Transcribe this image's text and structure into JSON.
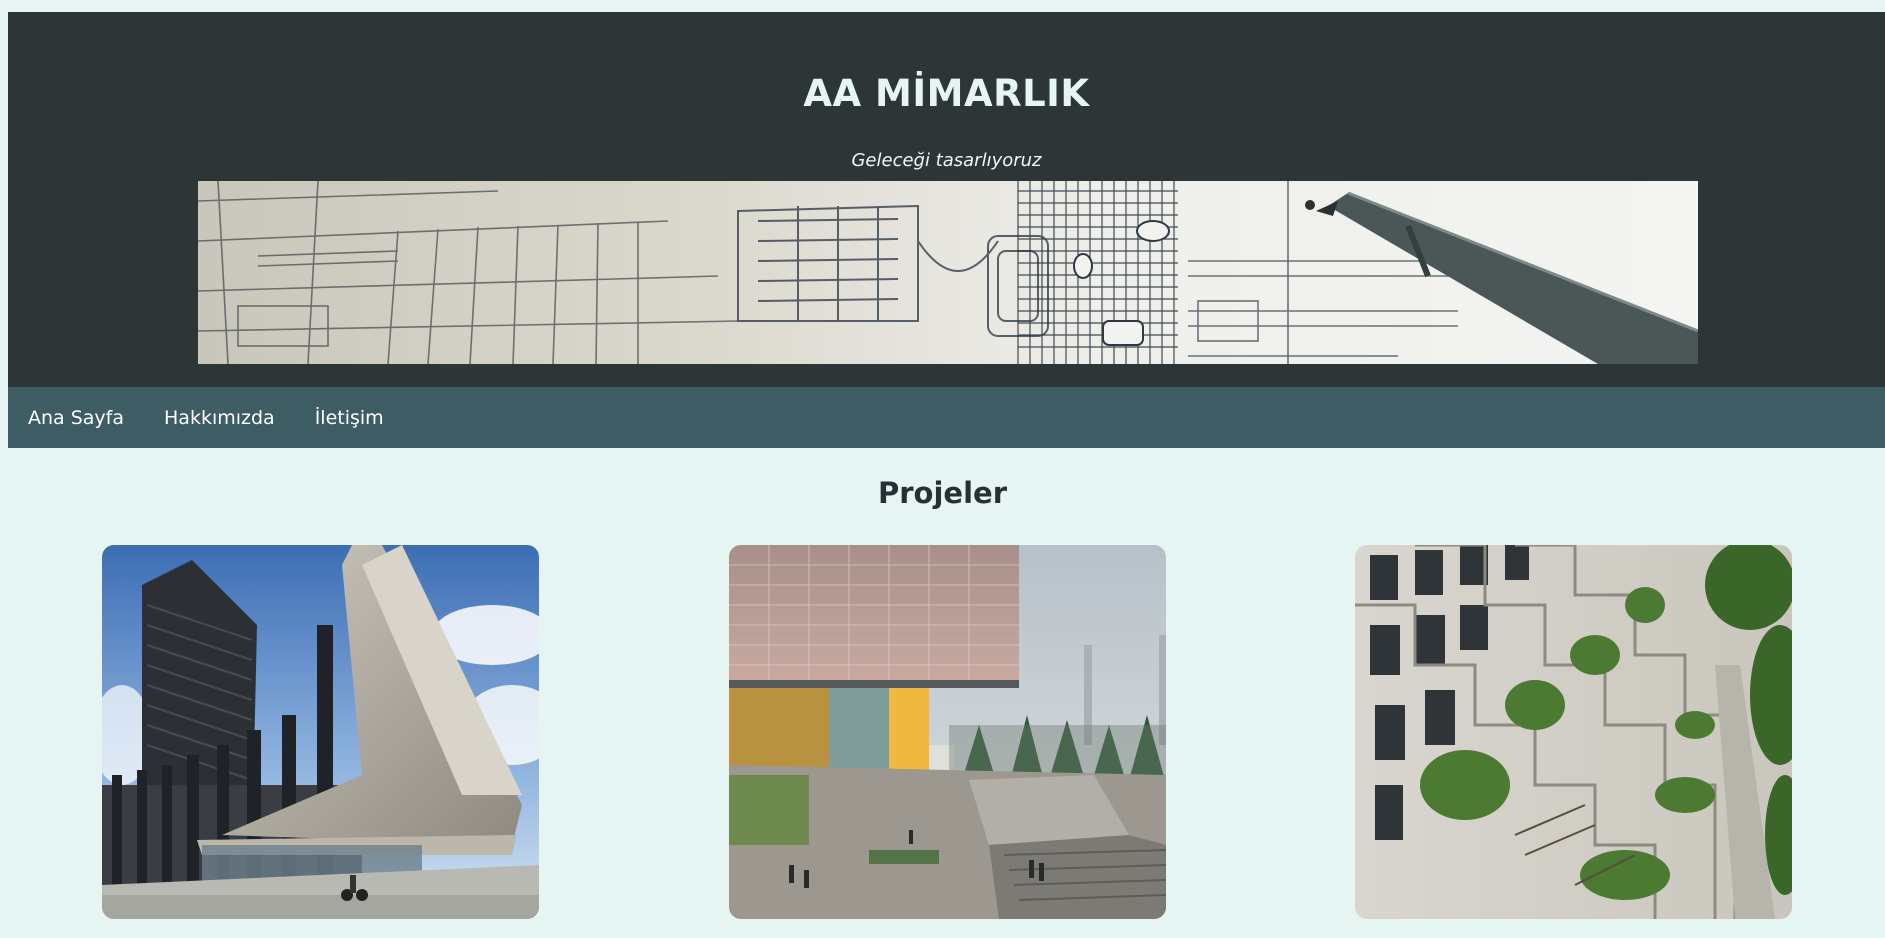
{
  "header": {
    "title": "AA MİMARLIK",
    "tagline": "Geleceği tasarlıyoruz",
    "banner_icon": "architectural-blueprint-with-pen"
  },
  "nav": {
    "items": [
      {
        "label": "Ana Sayfa"
      },
      {
        "label": "Hakkımızda"
      },
      {
        "label": "İletişim"
      }
    ]
  },
  "projects": {
    "title": "Projeler",
    "images": [
      "modern-building-cantilever-photo",
      "glass-facade-plaza-render-photo",
      "terraced-residential-building-photo"
    ]
  },
  "colors": {
    "page_bg": "#e6f5f2",
    "header_bg": "#2e3536",
    "nav_bg": "#3e5c64",
    "text_light": "#e6f5f2"
  }
}
